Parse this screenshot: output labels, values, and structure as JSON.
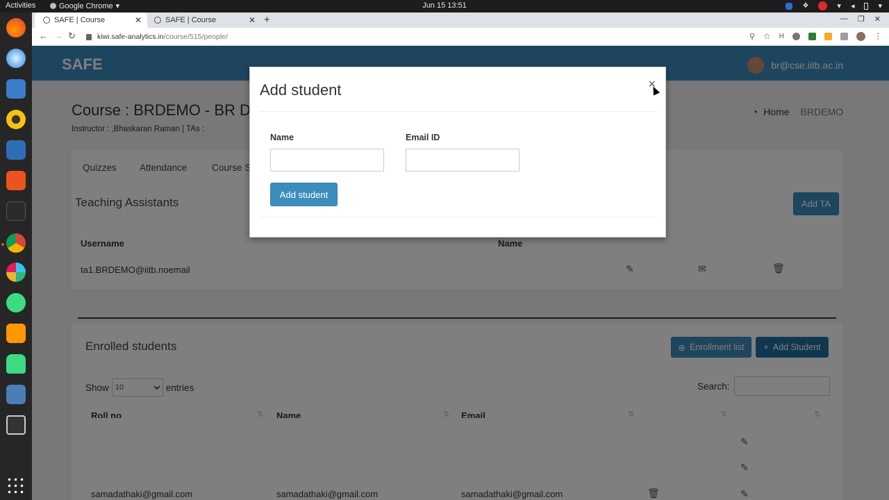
{
  "os": {
    "activities": "Activities",
    "app_name": "Google Chrome",
    "clock": "Jun 15  13:51"
  },
  "browser": {
    "tabs": [
      {
        "title": "SAFE | Course",
        "active": true
      },
      {
        "title": "SAFE | Course",
        "active": false
      }
    ],
    "new_tab": "+",
    "url_host": "kiwi.safe-analytics.in",
    "url_path": "/course/515/people/"
  },
  "site": {
    "brand": "SAFE",
    "user_email": "br@cse.iitb.ac.in",
    "course_title": "Course : BRDEMO - BR Dem",
    "instructor_line": "Instructor : ,Bhaskaran Raman | TAs :",
    "breadcrumb": {
      "home": "Home",
      "current": "BRDEMO"
    },
    "nav_tabs": [
      "Quizzes",
      "Attendance",
      "Course S"
    ],
    "ta_section": {
      "title": "Teaching Assistants",
      "add_button": "Add TA",
      "headers": [
        "Username",
        "Name"
      ],
      "rows": [
        {
          "username": "ta1.BRDEMO@iitb.noemail"
        }
      ]
    },
    "enrolled": {
      "title": "Enrolled students",
      "enroll_list_button": "Enrollment list",
      "add_student_button": "Add Student",
      "show_label": "Show",
      "entries_value": "10",
      "entries_label": "entries",
      "search_label": "Search:",
      "headers": [
        "Roll no",
        "Name",
        "Email"
      ],
      "visible_row": {
        "roll": "samadathaki@gmail.com",
        "name": "samadathaki@gmail.com",
        "email": "samadathaki@gmail.com"
      }
    }
  },
  "modal": {
    "title": "Add student",
    "close": "×",
    "name_label": "Name",
    "email_label": "Email ID",
    "submit": "Add student"
  },
  "colors": {
    "header_blue": "#3b8dbd",
    "button_blue": "#3c8dbc"
  }
}
